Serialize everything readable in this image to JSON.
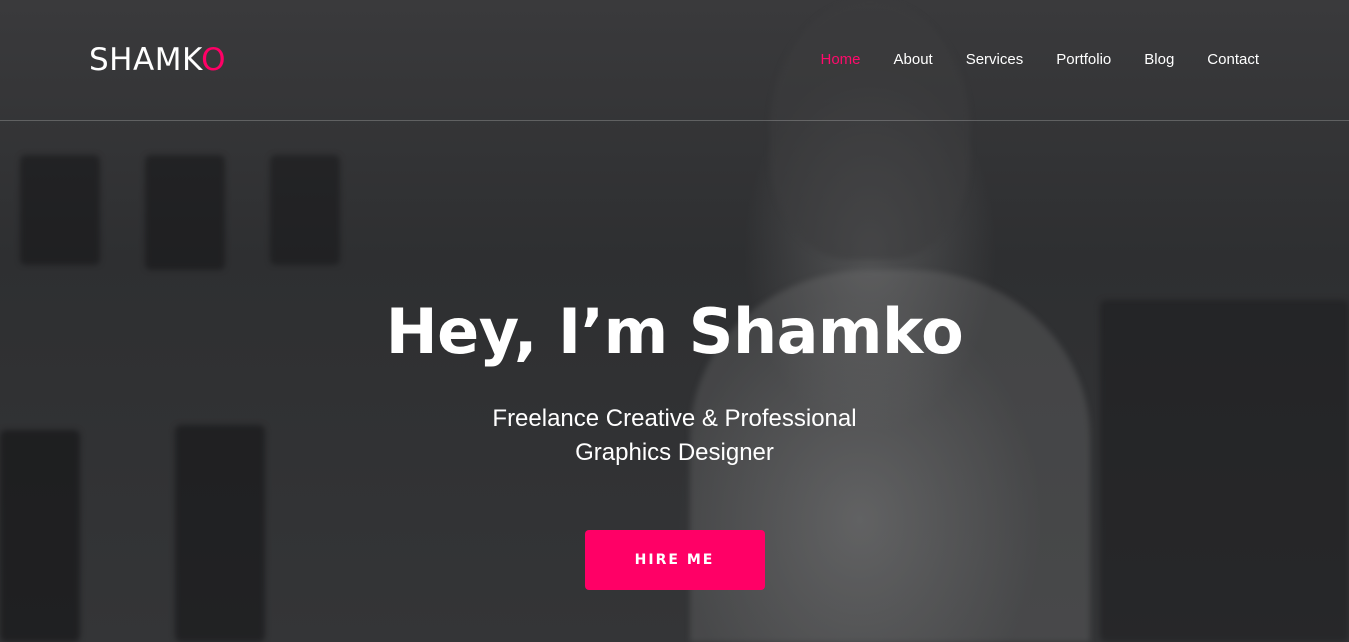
{
  "brand": {
    "logo_main": "SHAMK",
    "logo_accent": "O",
    "accent_color": "#ff0066"
  },
  "nav": {
    "items": [
      {
        "label": "Home",
        "active": true
      },
      {
        "label": "About",
        "active": false
      },
      {
        "label": "Services",
        "active": false
      },
      {
        "label": "Portfolio",
        "active": false
      },
      {
        "label": "Blog",
        "active": false
      },
      {
        "label": "Contact",
        "active": false
      }
    ]
  },
  "hero": {
    "heading": "Hey, I’m Shamko",
    "subtitle_line1": "Freelance Creative & Professional",
    "subtitle_line2": "Graphics Designer",
    "cta_label": "HIRE ME"
  }
}
